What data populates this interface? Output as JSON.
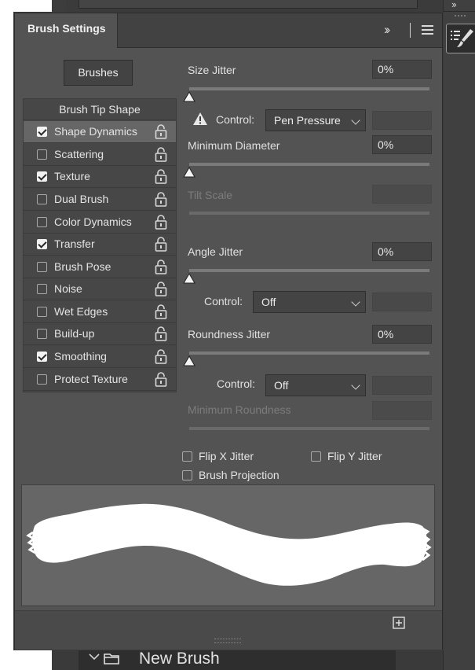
{
  "panel": {
    "tab_title": "Brush Settings",
    "brushes_button": "Brushes"
  },
  "sidebar": {
    "header": "Brush Tip Shape",
    "items": [
      {
        "label": "Shape Dynamics",
        "checked": true,
        "selected": true
      },
      {
        "label": "Scattering",
        "checked": false
      },
      {
        "label": "Texture",
        "checked": true
      },
      {
        "label": "Dual Brush",
        "checked": false
      },
      {
        "label": "Color Dynamics",
        "checked": false
      },
      {
        "label": "Transfer",
        "checked": true
      },
      {
        "label": "Brush Pose",
        "checked": false
      },
      {
        "label": "Noise",
        "checked": false
      },
      {
        "label": "Wet Edges",
        "checked": false
      },
      {
        "label": "Build-up",
        "checked": false
      },
      {
        "label": "Smoothing",
        "checked": true
      },
      {
        "label": "Protect Texture",
        "checked": false
      }
    ]
  },
  "settings": {
    "size_jitter": {
      "label": "Size Jitter",
      "value": "0%"
    },
    "size_control": {
      "label": "Control:",
      "value": "Pen Pressure"
    },
    "minimum_diameter": {
      "label": "Minimum Diameter",
      "value": "0%"
    },
    "tilt_scale": {
      "label": "Tilt Scale"
    },
    "angle_jitter": {
      "label": "Angle Jitter",
      "value": "0%"
    },
    "angle_control": {
      "label": "Control:",
      "value": "Off"
    },
    "roundness_jitter": {
      "label": "Roundness Jitter",
      "value": "0%"
    },
    "roundness_control": {
      "label": "Control:",
      "value": "Off"
    },
    "minimum_roundness": {
      "label": "Minimum Roundness"
    },
    "flip_x": "Flip X Jitter",
    "flip_y": "Flip Y Jitter",
    "brush_projection": "Brush Projection"
  },
  "layers": {
    "new_brush": "New Brush"
  },
  "icons": {
    "expand": "double-chevron-right-icon",
    "menu": "hamburger-menu-icon",
    "lock": "unlock-icon",
    "warning": "warning-icon",
    "new": "add-square-icon"
  },
  "colors": {
    "panel_bg": "#535353",
    "tab_bar": "#424242",
    "selected_row": "#666666",
    "preview_bg": "#666666",
    "stroke": "#ffffff"
  }
}
